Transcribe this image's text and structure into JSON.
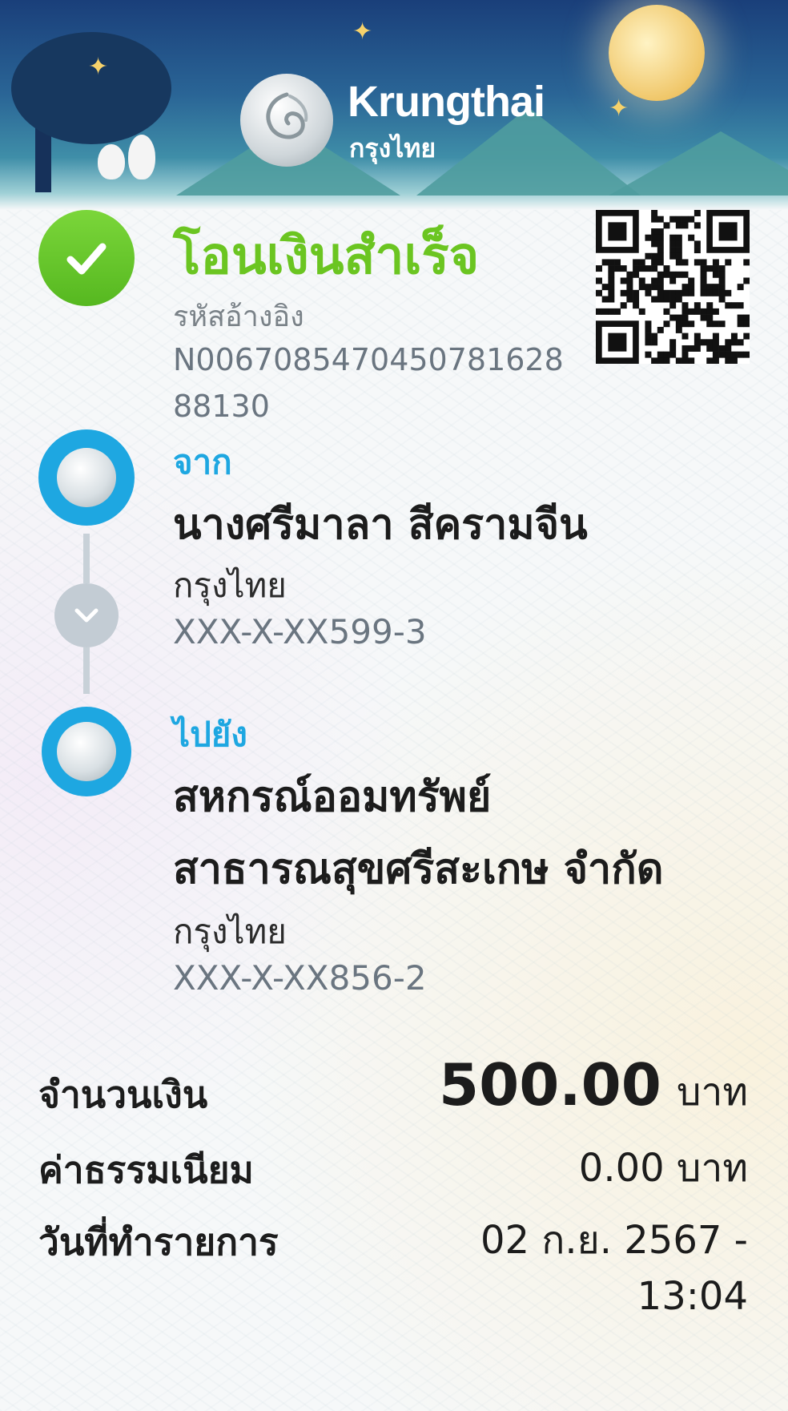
{
  "header": {
    "brand_en": "Krungthai",
    "brand_th": "กรุงไทย"
  },
  "status": {
    "title": "โอนเงินสำเร็จ",
    "ref_label": "รหัสอ้างอิง",
    "ref_value": "N006708547045078162888130"
  },
  "from": {
    "label": "จาก",
    "name": "นางศรีมาลา สีครามจีน",
    "bank": "กรุงไทย",
    "account": "XXX-X-XX599-3"
  },
  "to": {
    "label": "ไปยัง",
    "name_line1": "สหกรณ์ออมทรัพย์",
    "name_line2": "สาธารณสุขศรีสะเกษ จำกัด",
    "bank": "กรุงไทย",
    "account": "XXX-X-XX856-2"
  },
  "amount": {
    "label": "จำนวนเงิน",
    "value": "500.00",
    "unit": "บาท"
  },
  "fee": {
    "label": "ค่าธรรมเนียม",
    "value": "0.00 บาท"
  },
  "date": {
    "label": "วันที่ทำรายการ",
    "value_line1": "02 ก.ย. 2567 -",
    "value_line2": "13:04"
  },
  "colors": {
    "success_green": "#6bc521",
    "brand_blue": "#1ea7e1"
  }
}
